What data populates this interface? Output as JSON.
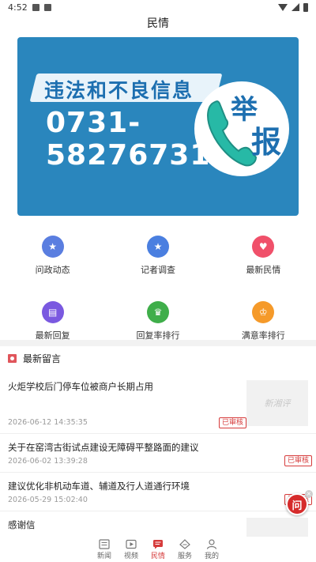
{
  "status_bar": {
    "time": "4:52"
  },
  "header": {
    "title": "民情"
  },
  "banner": {
    "heading": "违法和不良信息",
    "phone_line1": "0731-",
    "phone_line2": "58276731",
    "char1": "举",
    "char2": "报"
  },
  "quick_menu": [
    {
      "label": "问政动态",
      "icon": "star-badge-icon",
      "color": "#5a7ee0"
    },
    {
      "label": "记者调查",
      "icon": "star-badge-icon",
      "color": "#4a7fe0"
    },
    {
      "label": "最新民情",
      "icon": "heart-hand-icon",
      "color": "#f0506a"
    },
    {
      "label": "最新回复",
      "icon": "chat-bubble-icon",
      "color": "#7a59e0"
    },
    {
      "label": "回复率排行",
      "icon": "trophy-icon",
      "color": "#3fae4a"
    },
    {
      "label": "满意率排行",
      "icon": "crown-icon",
      "color": "#f59a2a"
    }
  ],
  "section": {
    "title": "最新留言"
  },
  "messages": [
    {
      "title": "火炬学校后门停车位被商户长期占用",
      "time": "2026-06-12 14:35:35",
      "badge": "已审核",
      "thumb": "新湘评"
    },
    {
      "title": "关于在窑湾古街试点建设无障碍平整路面的建议",
      "time": "2026-06-02 13:39:28",
      "badge": "已审核"
    },
    {
      "title": "建议优化非机动车道、辅道及行人道通行环境",
      "time": "2026-05-29 15:02:40",
      "badge": "已审核"
    },
    {
      "title": "感谢信"
    }
  ],
  "float_button": {
    "label": "问"
  },
  "tabs": [
    {
      "label": "新闻",
      "icon": "news-icon"
    },
    {
      "label": "视频",
      "icon": "video-icon"
    },
    {
      "label": "民情",
      "icon": "chat-icon",
      "active": true
    },
    {
      "label": "服务",
      "icon": "service-icon"
    },
    {
      "label": "我的",
      "icon": "profile-icon"
    }
  ],
  "colors": {
    "accent": "#d63b3b",
    "banner_bg": "#2a86bd"
  }
}
